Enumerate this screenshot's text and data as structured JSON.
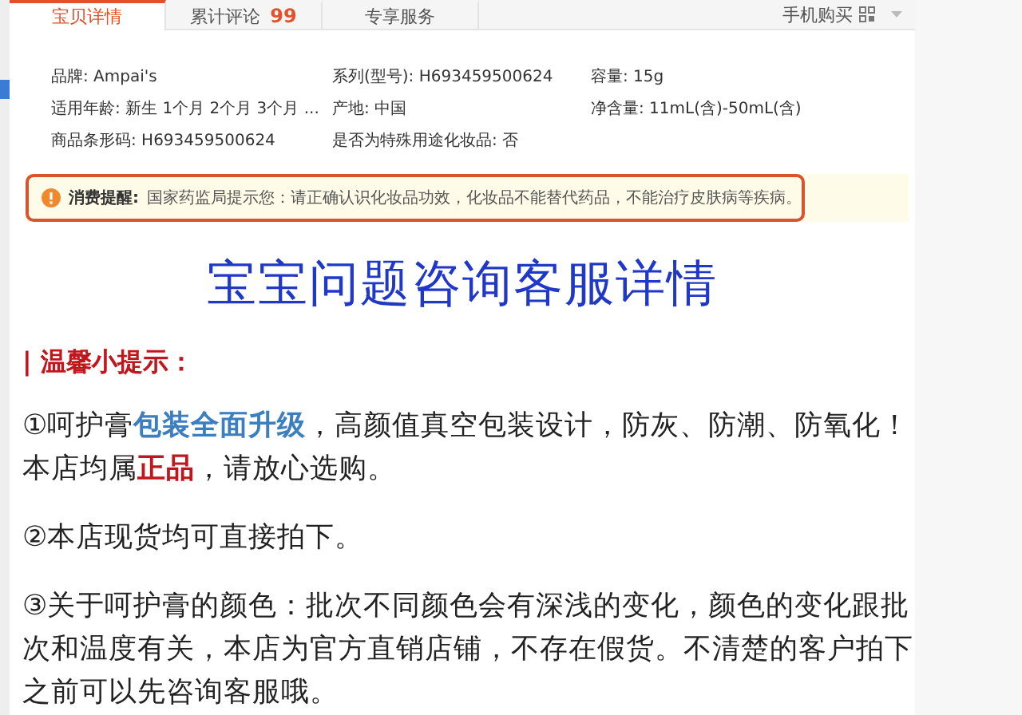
{
  "tabs": [
    {
      "label": "宝贝详情",
      "selected": true
    },
    {
      "label": "累计评论",
      "count": "99",
      "selected": false
    },
    {
      "label": "专享服务",
      "selected": false
    }
  ],
  "mobile_buy": {
    "label": "手机购买"
  },
  "specs": [
    {
      "text": "品牌: Ampai's"
    },
    {
      "text": "系列(型号): H693459500624"
    },
    {
      "text": "容量: 15g"
    },
    {
      "text": "适用年龄: 新生 1个月 2个月 3个月 ..."
    },
    {
      "text": "产地: 中国"
    },
    {
      "text": "净含量: 11mL(含)-50mL(含)"
    },
    {
      "text": "商品条形码: H693459500624"
    },
    {
      "text": "是否为特殊用途化妆品: 否"
    }
  ],
  "notice": {
    "label": "消费提醒:",
    "text": "国家药监局提示您：请正确认识化妆品功效，化妆品不能替代药品，不能治疗皮肤病等疾病。"
  },
  "heading": "宝宝问题咨询客服详情",
  "tip_title": "| 温馨小提示：",
  "paragraphs": [
    {
      "segments": [
        {
          "text": "①呵护膏",
          "kind": "text"
        },
        {
          "text": "包装全面升级",
          "kind": "highlight"
        },
        {
          "text": "，高颜值真空包装设计，防灰、防潮、防氧化！本店均属",
          "kind": "text"
        },
        {
          "text": "正品",
          "kind": "emphasis"
        },
        {
          "text": "，请放心选购。",
          "kind": "text"
        }
      ]
    },
    {
      "segments": [
        {
          "text": "②本店现货均可直接拍下。",
          "kind": "text"
        }
      ]
    },
    {
      "segments": [
        {
          "text": "③关于呵护膏的颜色：批次不同颜色会有深浅的变化，颜色的变化跟批次和温度有关，本店为官方直销店铺，不存在假货。不清楚的客户拍下之前可以先咨询客服哦。",
          "kind": "text"
        }
      ]
    }
  ]
}
